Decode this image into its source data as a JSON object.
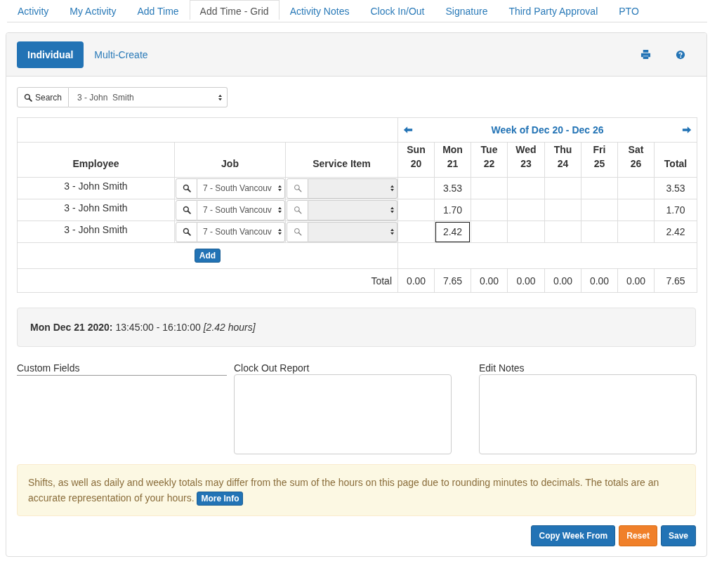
{
  "tabs": [
    {
      "label": "Activity",
      "selected": false
    },
    {
      "label": "My Activity",
      "selected": false
    },
    {
      "label": "Add Time",
      "selected": false
    },
    {
      "label": "Add Time - Grid",
      "selected": true
    },
    {
      "label": "Activity Notes",
      "selected": false
    },
    {
      "label": "Clock In/Out",
      "selected": false
    },
    {
      "label": "Signature",
      "selected": false
    },
    {
      "label": "Third Party Approval",
      "selected": false
    },
    {
      "label": "PTO",
      "selected": false
    }
  ],
  "mode_tabs": [
    {
      "label": "Individual",
      "selected": true
    },
    {
      "label": "Multi-Create",
      "selected": false
    }
  ],
  "employee_search": {
    "button": "Search",
    "value": "3 - John  Smith"
  },
  "grid": {
    "week_label": "Week of Dec 20 - Dec 26",
    "columns": [
      "Employee",
      "Job",
      "Service Item"
    ],
    "days": [
      {
        "name": "Sun",
        "date": "20"
      },
      {
        "name": "Mon",
        "date": "21"
      },
      {
        "name": "Tue",
        "date": "22"
      },
      {
        "name": "Wed",
        "date": "23"
      },
      {
        "name": "Thu",
        "date": "24"
      },
      {
        "name": "Fri",
        "date": "25"
      },
      {
        "name": "Sat",
        "date": "26"
      }
    ],
    "total_column": "Total",
    "rows": [
      {
        "employee": "3 - John Smith",
        "job": "7 - South Vancouv",
        "service_item_disabled": true,
        "hours": [
          {
            "selected": false
          },
          {
            "value": "3.53",
            "selected": false
          },
          {
            "selected": false
          },
          {
            "selected": false
          },
          {
            "selected": false
          },
          {
            "selected": false
          },
          {
            "selected": false
          }
        ],
        "total": "3.53"
      },
      {
        "employee": "3 - John Smith",
        "job": "7 - South Vancouv",
        "service_item_disabled": true,
        "hours": [
          {
            "selected": false
          },
          {
            "value": "1.70",
            "selected": false
          },
          {
            "selected": false
          },
          {
            "selected": false
          },
          {
            "selected": false
          },
          {
            "selected": false
          },
          {
            "selected": false
          }
        ],
        "total": "1.70"
      },
      {
        "employee": "3 - John Smith",
        "job": "7 - South Vancouv",
        "service_item_disabled": true,
        "hours": [
          {
            "selected": false
          },
          {
            "value": "2.42",
            "selected": true
          },
          {
            "selected": false
          },
          {
            "selected": false
          },
          {
            "selected": false
          },
          {
            "selected": false
          },
          {
            "selected": false
          }
        ],
        "total": "2.42"
      }
    ],
    "add_button": "Add",
    "totals_label": "Total",
    "day_totals": [
      "0.00",
      "7.65",
      "0.00",
      "0.00",
      "0.00",
      "0.00",
      "0.00"
    ],
    "grand_total": "7.65"
  },
  "shift_summary": "**Mon Dec 21 2020:** 13:45:00 - 16:10:00 *[2.42 hours]*",
  "notes": {
    "custom_fields": "Custom Fields",
    "clock_out_report": "Clock Out Report",
    "edit_notes": "Edit Notes"
  },
  "alert": {
    "text": "Shifts, as well as daily and weekly totals may differ from the sum of the hours on this page due to rounding minutes to decimals. The totals are an accurate representation of your hours.",
    "button": "More Info"
  },
  "actions": [
    {
      "label": "Copy Week From",
      "kind": "primary"
    },
    {
      "label": "Reset",
      "kind": "warning"
    },
    {
      "label": "Save",
      "kind": "primary"
    }
  ]
}
